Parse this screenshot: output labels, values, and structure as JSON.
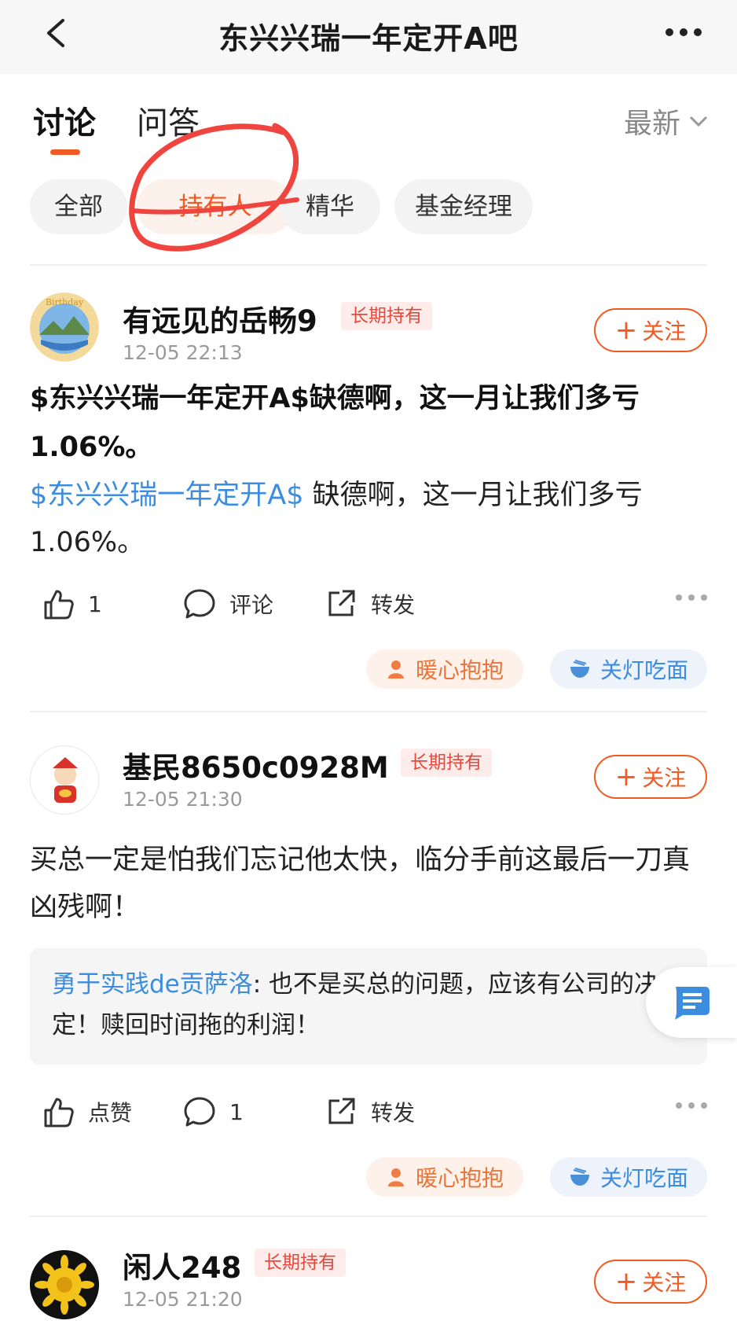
{
  "header": {
    "title": "东兴兴瑞一年定开A吧"
  },
  "tabs": [
    {
      "label": "讨论"
    },
    {
      "label": "问答"
    }
  ],
  "sort": {
    "label": "最新"
  },
  "filters": [
    {
      "label": "全部"
    },
    {
      "label": "持有人"
    },
    {
      "label": "精华"
    },
    {
      "label": "基金经理"
    }
  ],
  "follow_label": "关注",
  "posts": [
    {
      "username": "有远见的岳畅9",
      "badge": "长期持有",
      "time": "12-05 22:13",
      "title": "$东兴兴瑞一年定开A$缺德啊，这一月让我们多亏1.06%。",
      "body_link": "$东兴兴瑞一年定开A$",
      "body_text": " 缺德啊，这一月让我们多亏1.06%。",
      "like": "1",
      "comment": "评论",
      "share": "转发",
      "react_hug": "暖心抱抱",
      "react_noodle": "关灯吃面"
    },
    {
      "username": "基民8650c0928M",
      "badge": "长期持有",
      "time": "12-05 21:30",
      "body_text": "买总一定是怕我们忘记他太快，临分手前这最后一刀真凶残啊！",
      "quote_name": "勇于实践de贡萨洛",
      "quote_text": ": 也不是买总的问题，应该有公司的决定！赎回时间拖的利润！",
      "like": "点赞",
      "comment": "1",
      "share": "转发",
      "react_hug": "暖心抱抱",
      "react_noodle": "关灯吃面"
    },
    {
      "username": "闲人248",
      "badge": "长期持有",
      "time": "12-05 21:20"
    }
  ]
}
